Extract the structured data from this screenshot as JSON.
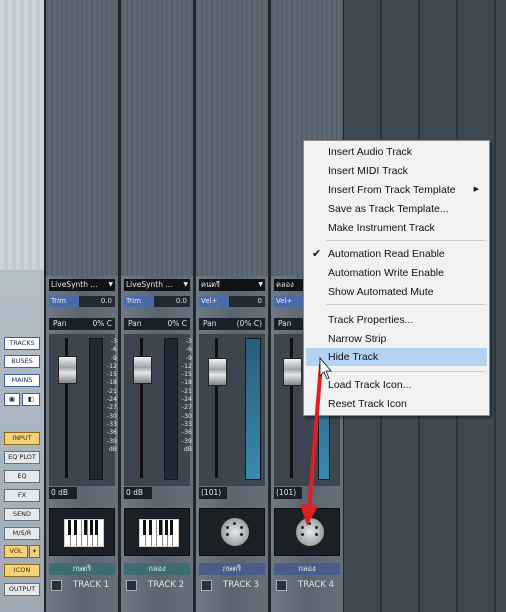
{
  "left_buttons": {
    "tracks": "TRACKS",
    "buses": "BUSES",
    "mains": "MAINS",
    "input": "INPUT",
    "eq_plot": "EQ PLOT",
    "eq": "EQ",
    "fx": "FX",
    "send": "SEND",
    "msr": "M/S/R",
    "vol": "VOL",
    "icon": "ICON",
    "output": "OUTPUT"
  },
  "tracks": [
    {
      "instrument": "LiveSynth ...",
      "param_label": "Trim",
      "param_value": "0.0",
      "pan_label": "Pan",
      "pan_value": "0% C",
      "volume": "0 dB",
      "icon": "piano-icon",
      "name": "กษตริ",
      "label": "TRACK 1"
    },
    {
      "instrument": "LiveSynth ...",
      "param_label": "Trim",
      "param_value": "0.0",
      "pan_label": "Pan",
      "pan_value": "0% C",
      "volume": "0 dB",
      "icon": "piano-icon",
      "name": "กลอง",
      "label": "TRACK 2"
    },
    {
      "instrument": "คนตรี",
      "param_label": "Vel+",
      "param_value": "0",
      "pan_label": "Pan",
      "pan_value": "(0% C)",
      "volume": "(101)",
      "icon": "midi-icon",
      "name": "กษตริ",
      "label": "TRACK 3"
    },
    {
      "instrument": "คลอง",
      "param_label": "Vel+",
      "param_value": "",
      "pan_label": "Pan",
      "pan_value": "",
      "volume": "(101)",
      "icon": "midi-icon",
      "name": "กลอง",
      "label": "TRACK 4"
    }
  ],
  "meter_scale": [
    "-3",
    "-6",
    "-9",
    "-12",
    "-15",
    "-18",
    "-21",
    "-24",
    "-27",
    "-30",
    "-33",
    "-36",
    "-39"
  ],
  "meter_scale_bottom": "dB",
  "context_menu": {
    "items": [
      {
        "label": "Insert Audio Track"
      },
      {
        "label": "Insert MIDI Track"
      },
      {
        "label": "Insert From Track Template"
      },
      {
        "label": "Save as Track Template..."
      },
      {
        "label": "Make Instrument Track"
      },
      {
        "label": "Automation Read Enable"
      },
      {
        "label": "Automation Write Enable"
      },
      {
        "label": "Show Automated Mute"
      },
      {
        "label": "Track Properties..."
      },
      {
        "label": "Narrow Strip"
      },
      {
        "label": "Hide Track"
      },
      {
        "label": "Load Track Icon..."
      },
      {
        "label": "Reset Track Icon"
      }
    ],
    "checked_item": "Automation Read Enable",
    "highlighted_item": "Hide Track",
    "submenu_item": "Insert From Track Template"
  },
  "colors": {
    "highlight": "#b3d2f4",
    "arrow": "#e02020",
    "accent_blue": "#4b6aa8"
  }
}
